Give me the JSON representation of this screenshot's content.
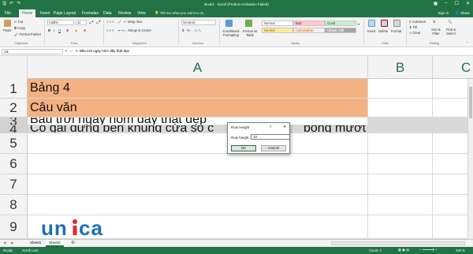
{
  "titlebar": {
    "title": "Book1 - Excel (Product Activation Failed)",
    "save_icon": "save-icon",
    "undo_icon": "undo-icon",
    "redo_icon": "redo-icon"
  },
  "tabs": {
    "items": [
      "File",
      "Home",
      "Insert",
      "Page Layout",
      "Formulas",
      "Data",
      "Review",
      "View"
    ],
    "tell_me": "Tell me what you want to do...",
    "sign_in": "Sign in",
    "share": "Share"
  },
  "ribbon": {
    "clipboard": {
      "paste": "Paste",
      "cut": "Cut",
      "copy": "Copy",
      "format_painter": "Format Painter",
      "label": "Clipboard"
    },
    "font": {
      "name": "Calibri",
      "size": "11",
      "label": "Font"
    },
    "alignment": {
      "wrap_text": "Wrap Text",
      "merge_center": "Merge & Center",
      "label": "Alignment"
    },
    "number": {
      "format": "General",
      "label": "Number"
    },
    "styles": {
      "conditional": "Conditional Formatting",
      "format_as_table": "Format as Table",
      "cells": [
        "Normal",
        "Bad",
        "Good",
        "Neutral",
        "Calculation",
        "Check Cell"
      ],
      "label": "Styles"
    },
    "cells": {
      "insert": "Insert",
      "delete": "Delete",
      "format": "Format",
      "label": "Cells"
    },
    "editing": {
      "autosum": "AutoSum",
      "fill": "Fill",
      "clear": "Clear",
      "sort_filter": "Sort & Filter",
      "find_select": "Find & Select",
      "label": "Editing"
    }
  },
  "formula_bar": {
    "namebox": "A3",
    "content": "Bầu trời ngày hôm đấy thật đẹp"
  },
  "grid": {
    "columns": [
      "A",
      "B",
      "C"
    ],
    "rows": [
      {
        "num": "1",
        "a": "Bảng 4"
      },
      {
        "num": "2",
        "a": "Câu văn"
      },
      {
        "num": "3",
        "a": "Bầu trời ngày hôm đấy thật đẹp"
      },
      {
        "num": "4",
        "a": "Cô gái đứng bên khung cửa sổ c"
      },
      {
        "num": "5",
        "a": ""
      },
      {
        "num": "6",
        "a": ""
      },
      {
        "num": "7",
        "a": ""
      },
      {
        "num": "8",
        "a": ""
      },
      {
        "num": "9",
        "a": ""
      }
    ],
    "row4_tail": "bồng mượt"
  },
  "dialog": {
    "title": "Row Height",
    "help": "?",
    "close": "✕",
    "label": "Row height:",
    "value": "10",
    "ok": "OK",
    "cancel": "Cancel"
  },
  "sheets": {
    "tabs": [
      "Sheet1",
      "Sheet2"
    ],
    "active": "Sheet2"
  },
  "status": {
    "ready": "Ready",
    "scroll_lock": "Scroll Lock",
    "count": "Count: 2",
    "zoom": "340 %"
  },
  "watermark": {
    "text": "unica"
  },
  "colors": {
    "excel_green": "#217346",
    "header_fill": "#f4b183",
    "selected_fill": "#d9d9d9"
  }
}
